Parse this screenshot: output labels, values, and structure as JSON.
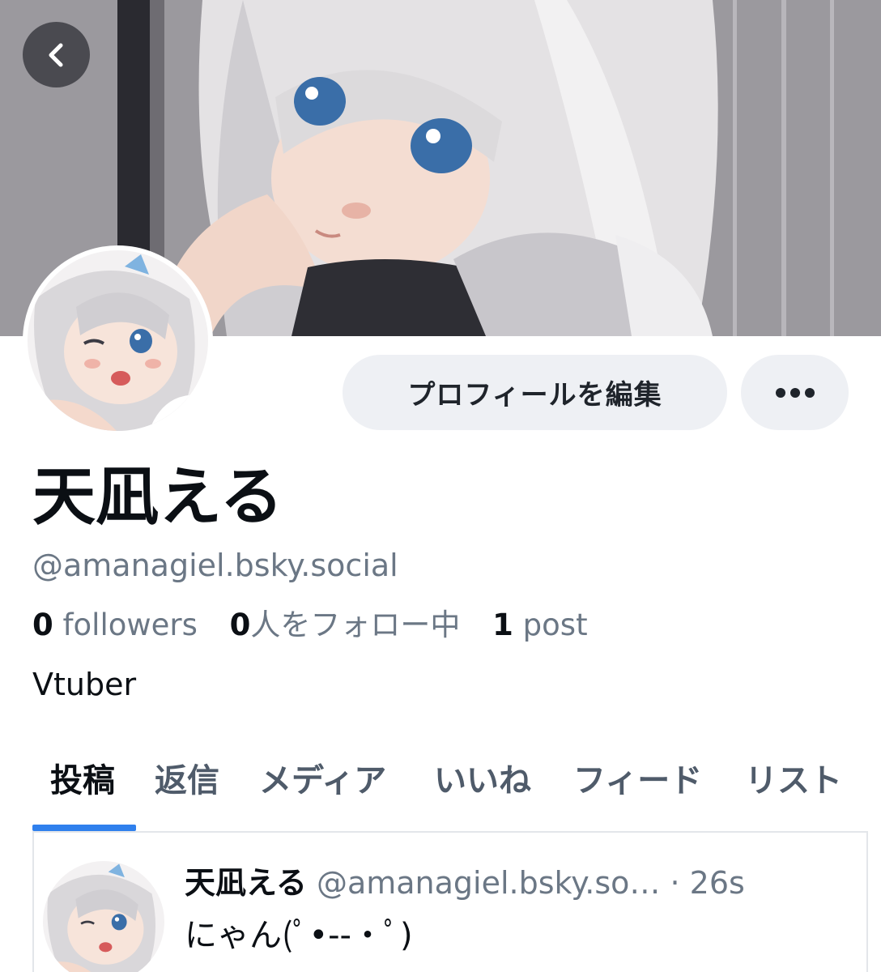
{
  "profile": {
    "display_name": "天凪える",
    "handle": "@amanagiel.bsky.social",
    "bio": "Vtuber",
    "edit_label": "プロフィールを編集"
  },
  "stats": {
    "followers_count": "0",
    "followers_label": " followers",
    "following_count": "0",
    "following_label": "人をフォロー中",
    "posts_count": "1",
    "posts_label": " post"
  },
  "tabs": [
    {
      "label": "投稿",
      "active": true
    },
    {
      "label": "返信"
    },
    {
      "label": "メディア"
    },
    {
      "label": "いいね"
    },
    {
      "label": "フィード"
    },
    {
      "label": "リスト"
    }
  ],
  "post": {
    "author_name": "天凪える",
    "author_handle": "@amanagiel.bsky.so…",
    "separator": " · ",
    "time": "26s",
    "text": "にゃん(ﾟ•-‐•ﾟ)"
  },
  "icons": {
    "back": "chevron-left-icon",
    "more": "ellipsis-icon"
  },
  "colors": {
    "accent": "#2f80ed",
    "muted_text": "#6b7785",
    "button_bg": "#eef0f4"
  }
}
